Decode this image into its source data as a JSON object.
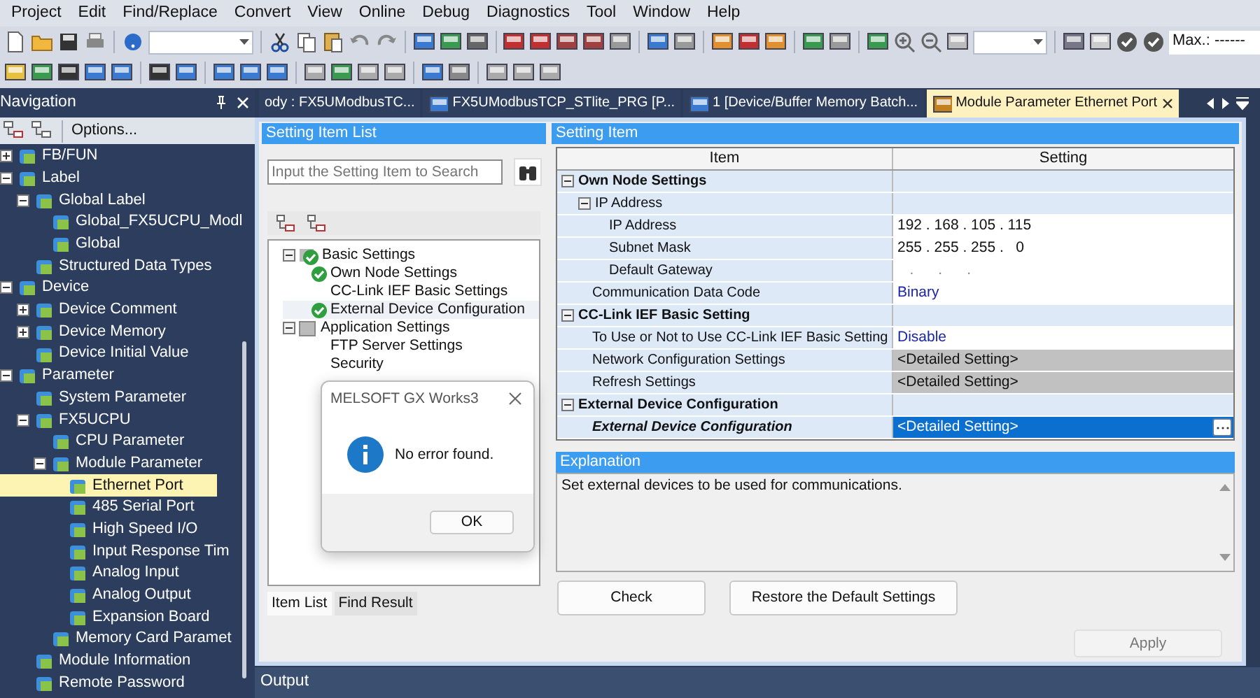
{
  "menu": [
    "Project",
    "Edit",
    "Find/Replace",
    "Convert",
    "View",
    "Online",
    "Debug",
    "Diagnostics",
    "Tool",
    "Window",
    "Help"
  ],
  "toolbar": {
    "max_field": "Max.: ------"
  },
  "navigation": {
    "title": "Navigation",
    "options": "Options...",
    "items": [
      {
        "label": "FB/FUN",
        "expanded": false,
        "selected": false
      },
      {
        "label": "Label",
        "expanded": true,
        "selected": false,
        "children": [
          {
            "label": "Global Label",
            "expanded": true,
            "selected": false,
            "children": [
              {
                "label": "Global_FX5UCPU_Modl",
                "selected": false
              },
              {
                "label": "Global",
                "selected": false
              }
            ]
          },
          {
            "label": "Structured Data Types",
            "selected": false
          }
        ]
      },
      {
        "label": "Device",
        "expanded": true,
        "selected": false,
        "children": [
          {
            "label": "Device Comment",
            "expanded": false,
            "selected": false
          },
          {
            "label": "Device Memory",
            "expanded": false,
            "selected": false
          },
          {
            "label": "Device Initial Value",
            "selected": false
          }
        ]
      },
      {
        "label": "Parameter",
        "expanded": true,
        "selected": false,
        "children": [
          {
            "label": "System Parameter",
            "selected": false
          },
          {
            "label": "FX5UCPU",
            "expanded": true,
            "selected": false,
            "children": [
              {
                "label": "CPU Parameter",
                "selected": false
              },
              {
                "label": "Module Parameter",
                "expanded": true,
                "selected": false,
                "children": [
                  {
                    "label": "Ethernet Port",
                    "selected": true
                  },
                  {
                    "label": "485 Serial Port",
                    "selected": false
                  },
                  {
                    "label": "High Speed I/O",
                    "selected": false
                  },
                  {
                    "label": "Input Response Tim",
                    "selected": false
                  },
                  {
                    "label": "Analog Input",
                    "selected": false
                  },
                  {
                    "label": "Analog Output",
                    "selected": false
                  },
                  {
                    "label": "Expansion Board",
                    "selected": false
                  }
                ]
              },
              {
                "label": "Memory Card Paramet",
                "selected": false
              }
            ]
          },
          {
            "label": "Module Information",
            "selected": false
          },
          {
            "label": "Remote Password",
            "selected": false
          }
        ]
      }
    ]
  },
  "tabs": [
    {
      "label": "ody : FX5UModbusTC...",
      "selected": false,
      "has_icon": false
    },
    {
      "label": "FX5UModbusTCP_STlite_PRG [P...",
      "selected": false,
      "has_icon": true
    },
    {
      "label": "1 [Device/Buffer Memory Batch...",
      "selected": false,
      "has_icon": true
    },
    {
      "label": "Module Parameter Ethernet Port",
      "selected": true,
      "has_icon": true
    }
  ],
  "setting_item_list": {
    "title": "Setting Item List",
    "search": {
      "placeholder": "Input the Setting Item to Search"
    },
    "items": [
      {
        "label": "Basic Settings",
        "checked": true,
        "expanded": true,
        "selected": false,
        "children": [
          {
            "label": "Own Node Settings",
            "checked": true,
            "selected": false
          },
          {
            "label": "CC-Link IEF Basic Settings",
            "checked": false,
            "selected": false
          },
          {
            "label": "External Device Configuration",
            "checked": true,
            "selected": true
          }
        ]
      },
      {
        "label": "Application Settings",
        "checked": false,
        "expanded": true,
        "selected": false,
        "children": [
          {
            "label": "FTP Server Settings",
            "checked": false,
            "selected": false
          },
          {
            "label": "Security",
            "checked": false,
            "selected": false
          }
        ]
      }
    ],
    "bottom_tabs": [
      {
        "label": "Item List",
        "selected": true
      },
      {
        "label": "Find Result",
        "selected": false
      }
    ]
  },
  "setting_item": {
    "title": "Setting Item",
    "columns": [
      "Item",
      "Setting"
    ],
    "rows": [
      {
        "label": "Own Node Settings",
        "kind": "section",
        "expanded": true,
        "selected": false,
        "children": [
          {
            "label": "IP Address",
            "kind": "group",
            "expanded": true,
            "selected": false,
            "children": [
              {
                "label": "IP Address",
                "kind": "text",
                "value": "192 . 168 . 105 . 115",
                "selected": false
              },
              {
                "label": "Subnet Mask",
                "kind": "text",
                "value": "255 . 255 . 255 .   0",
                "selected": false
              },
              {
                "label": "Default Gateway",
                "kind": "blank",
                "value": "   .      .      .",
                "selected": false
              }
            ]
          },
          {
            "label": "Communication Data Code",
            "kind": "choice",
            "value": "Binary",
            "selected": false
          }
        ]
      },
      {
        "label": "CC-Link IEF Basic Setting",
        "kind": "section",
        "expanded": true,
        "selected": false,
        "children": [
          {
            "label": "To Use or Not to Use CC-Link IEF Basic Setting",
            "kind": "choice",
            "value": "Disable",
            "selected": false
          },
          {
            "label": "Network Configuration Settings",
            "kind": "detail",
            "value": "<Detailed Setting>",
            "selected": false
          },
          {
            "label": "Refresh Settings",
            "kind": "detail",
            "value": "<Detailed Setting>",
            "selected": false
          }
        ]
      },
      {
        "label": "External Device Configuration",
        "kind": "section",
        "expanded": true,
        "selected": false,
        "children": [
          {
            "label": "External Device Configuration",
            "kind": "detail",
            "value": "<Detailed Setting>",
            "selected": true
          }
        ]
      }
    ]
  },
  "explanation": {
    "title": "Explanation",
    "text": "Set external devices to be used for communications."
  },
  "buttons": [
    "Check",
    "Restore the Default Settings"
  ],
  "apply_button": {
    "label": "Apply",
    "disabled": true
  },
  "dialog": {
    "title": "MELSOFT GX Works3",
    "message": "No error found.",
    "button": "OK"
  },
  "output": {
    "title": "Output"
  }
}
